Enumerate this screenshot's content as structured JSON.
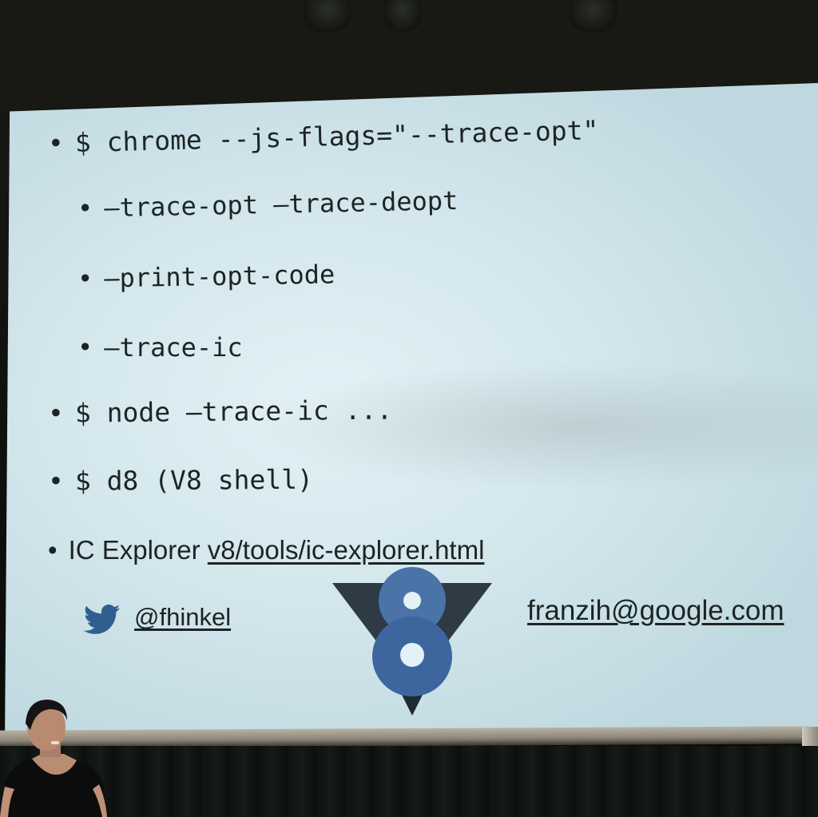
{
  "slide": {
    "bullets": [
      {
        "bullet": "•",
        "text": "$ chrome --js-flags=\"--trace-opt\""
      },
      {
        "bullet": "•",
        "text": "—trace-opt —trace-deopt"
      },
      {
        "bullet": "•",
        "text": "—print-opt-code"
      },
      {
        "bullet": "•",
        "text": "—trace-ic"
      },
      {
        "bullet": "•",
        "text": "$ node —trace-ic ..."
      },
      {
        "bullet": "•",
        "text": "$ d8 (V8 shell)"
      }
    ],
    "ic_explorer": {
      "bullet": "•",
      "label": "IC Explorer ",
      "link": "v8/tools/ic-explorer.html"
    },
    "twitter_handle": "@fhinkel",
    "email": "franzih@google.com",
    "logo_text": "V8"
  },
  "colors": {
    "screen_bg": "#d8ebf0",
    "text": "#1d2424",
    "twitter_blue": "#2f5f8f",
    "v8_blue": "#4a73a8",
    "v8_dark": "#2e3a44"
  },
  "icons": [
    "twitter-icon",
    "v8-logo"
  ]
}
